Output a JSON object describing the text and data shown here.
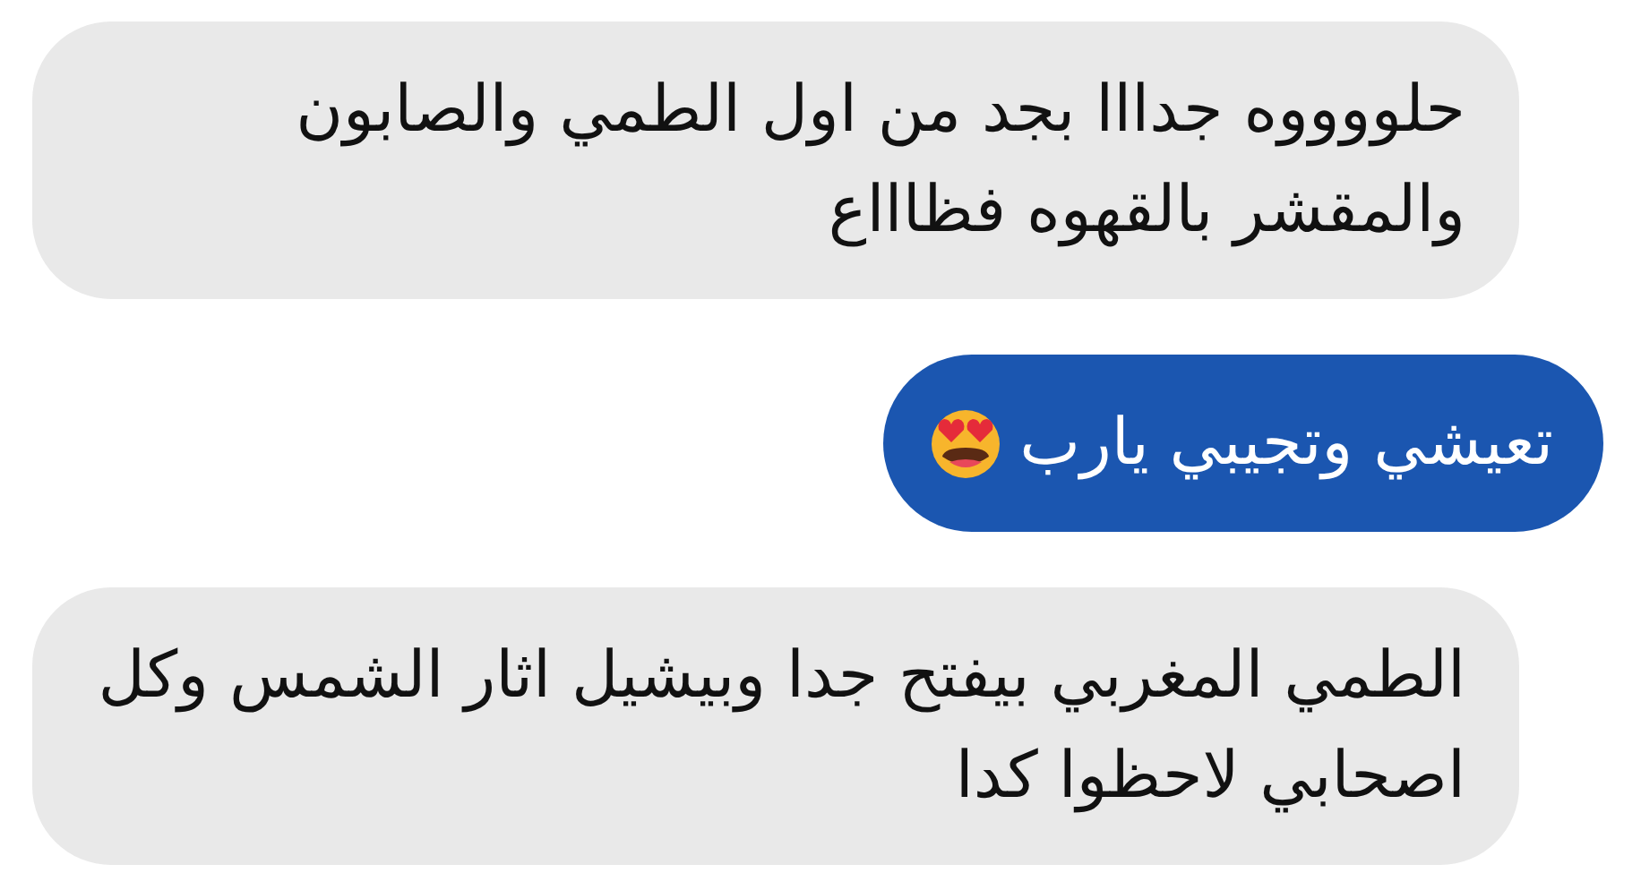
{
  "messages": [
    {
      "kind": "incoming",
      "text": "حلووووه جدااا بجد من اول الطمي والصابون\nوالمقشر بالقهوه فظاااع",
      "has_emoji": false
    },
    {
      "kind": "outgoing",
      "text": "تعيشي وتجيبي يارب",
      "has_emoji": true
    },
    {
      "kind": "incoming",
      "text": "الطمي المغربي بيفتح جدا وبيشيل اثار الشمس وكل\nاصحابي لاحظوا كدا",
      "has_emoji": false
    }
  ]
}
